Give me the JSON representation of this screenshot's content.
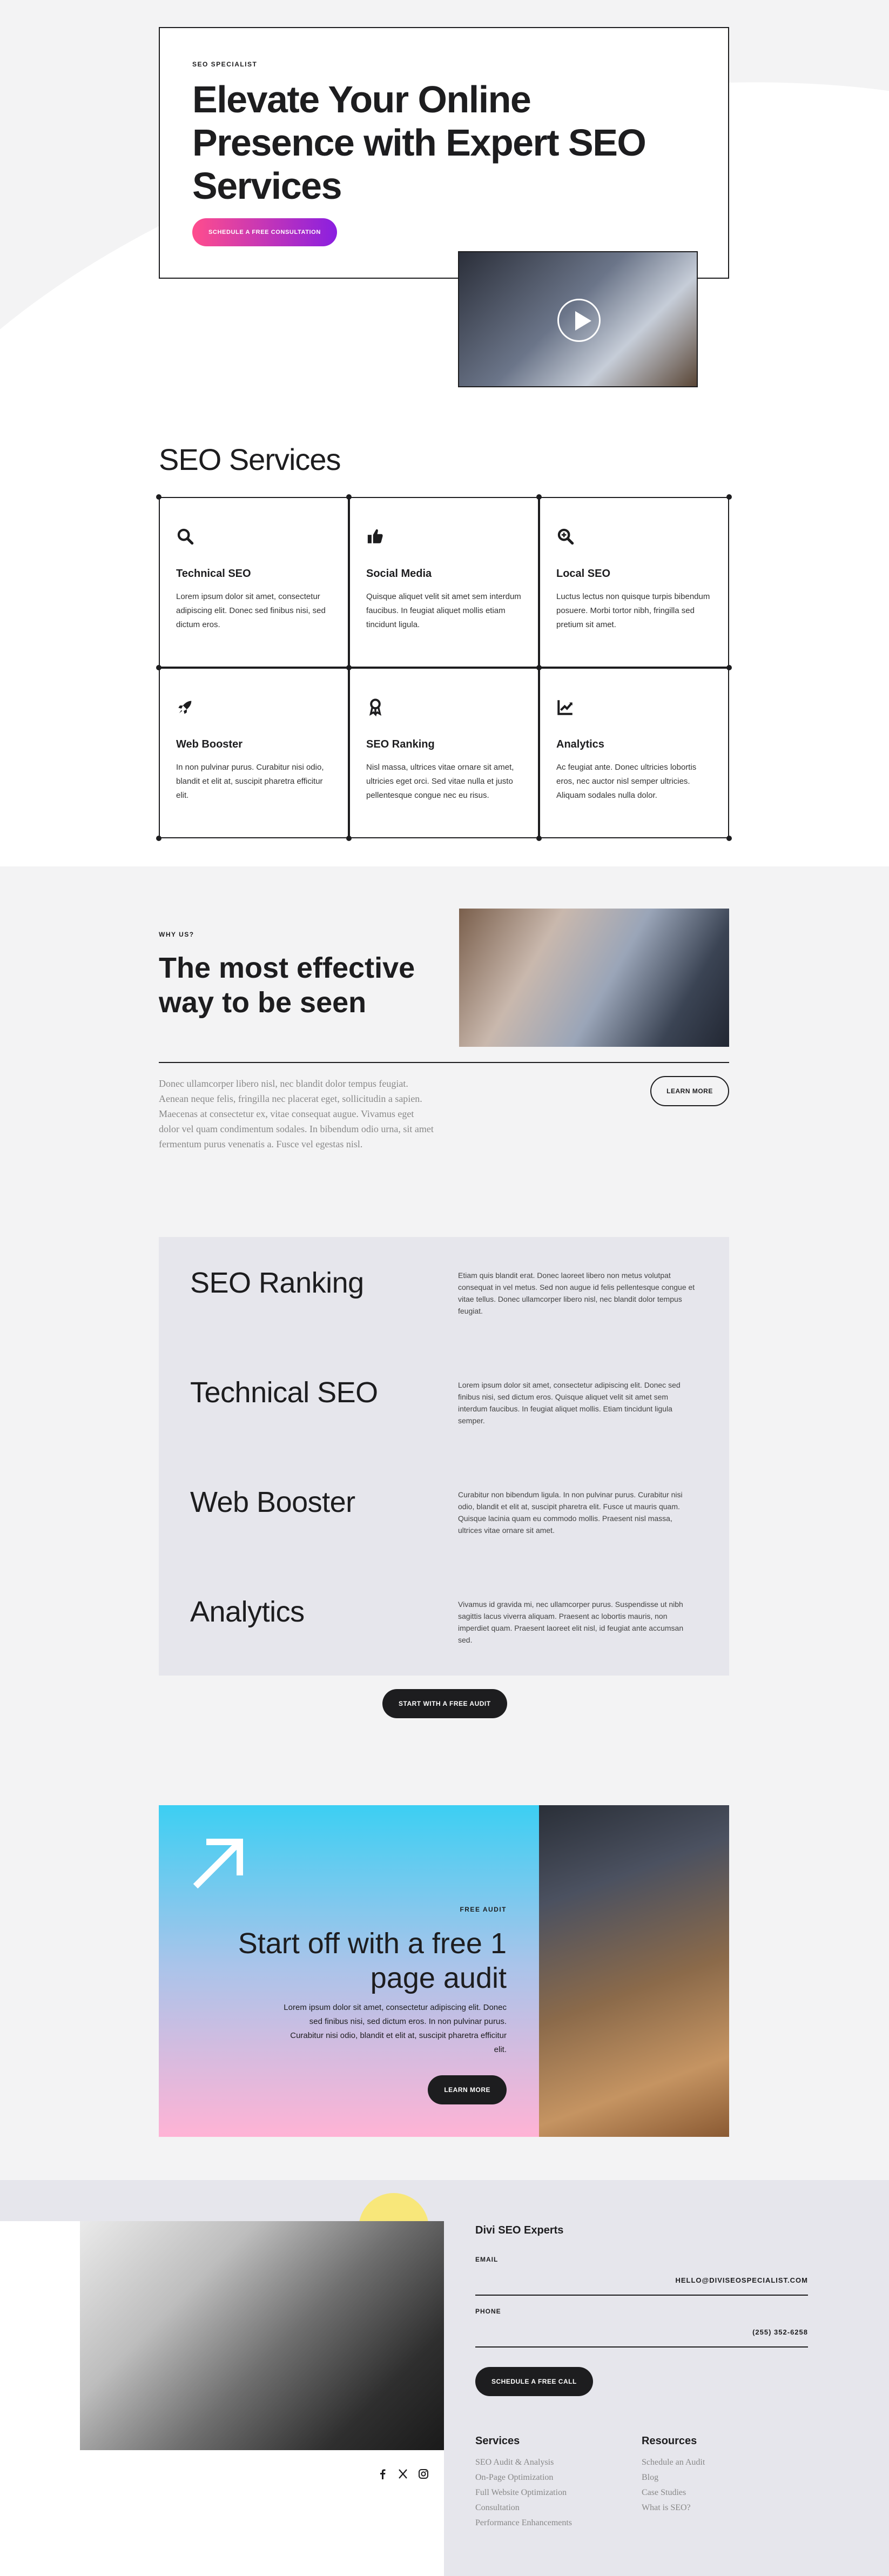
{
  "hero": {
    "eyebrow": "SEO SPECIALIST",
    "title": "Elevate Your Online Presence with Expert SEO Services",
    "cta": "SCHEDULE A FREE CONSULTATION"
  },
  "services": {
    "title": "SEO Services",
    "items": [
      {
        "icon": "search-icon",
        "title": "Technical SEO",
        "text": "Lorem ipsum dolor sit amet, consectetur adipiscing elit. Donec sed finibus nisi, sed dictum eros."
      },
      {
        "icon": "thumbs-up-icon",
        "title": "Social Media",
        "text": "Quisque aliquet velit sit amet sem interdum faucibus. In feugiat aliquet mollis etiam tincidunt ligula."
      },
      {
        "icon": "search-plus-icon",
        "title": "Local SEO",
        "text": "Luctus lectus non quisque turpis bibendum posuere. Morbi tortor nibh, fringilla sed pretium sit amet."
      },
      {
        "icon": "rocket-icon",
        "title": "Web Booster",
        "text": "In non pulvinar purus. Curabitur nisi odio, blandit et elit at, suscipit pharetra efficitur elit."
      },
      {
        "icon": "award-icon",
        "title": "SEO Ranking",
        "text": "Nisl massa, ultrices vitae ornare sit amet, ultricies eget orci. Sed vitae nulla et justo pellentesque congue nec eu risus."
      },
      {
        "icon": "chart-line-icon",
        "title": "Analytics",
        "text": "Ac feugiat ante. Donec ultricies lobortis eros, nec auctor nisl semper ultricies. Aliquam sodales nulla dolor."
      }
    ]
  },
  "why": {
    "eyebrow": "WHY US?",
    "title": "The most effective way to be seen",
    "text": "Donec ullamcorper libero nisl, nec blandit dolor tempus feugiat. Aenean neque felis, fringilla nec placerat eget, sollicitudin a sapien. Maecenas at consectetur ex, vitae consequat augue. Vivamus eget dolor vel quam condimentum sodales. In bibendum odio urna, sit amet fermentum purus venenatis a. Fusce vel egestas nisl.",
    "cta": "LEARN MORE"
  },
  "features": {
    "items": [
      {
        "title": "SEO Ranking",
        "text": "Etiam quis blandit erat. Donec laoreet libero non metus volutpat consequat in vel metus. Sed non augue id felis pellentesque congue et vitae tellus. Donec ullamcorper libero nisl, nec blandit dolor tempus feugiat."
      },
      {
        "title": "Technical SEO",
        "text": "Lorem ipsum dolor sit amet, consectetur adipiscing elit. Donec sed finibus nisi, sed dictum eros. Quisque aliquet velit sit amet sem interdum faucibus. In feugiat aliquet mollis. Etiam tincidunt ligula semper."
      },
      {
        "title": "Web Booster",
        "text": "Curabitur non bibendum ligula. In non pulvinar purus. Curabitur nisi odio, blandit et elit at, suscipit pharetra elit. Fusce ut mauris quam. Quisque lacinia quam eu commodo mollis. Praesent nisl massa, ultrices vitae ornare sit amet."
      },
      {
        "title": "Analytics",
        "text": "Vivamus id gravida mi, nec ullamcorper purus. Suspendisse ut nibh sagittis lacus viverra aliquam. Praesent ac lobortis mauris, non imperdiet quam. Praesent laoreet elit nisl, id feugiat ante accumsan sed."
      }
    ],
    "cta": "START WITH A FREE AUDIT"
  },
  "audit": {
    "eyebrow": "FREE AUDIT",
    "title": "Start off with a free 1 page audit",
    "text": "Lorem ipsum dolor sit amet, consectetur adipiscing elit. Donec sed finibus nisi, sed dictum eros. In non pulvinar purus. Curabitur nisi odio, blandit et elit at, suscipit pharetra efficitur elit.",
    "cta": "LEARN MORE"
  },
  "footer": {
    "brand": "Divi SEO Experts",
    "email_label": "EMAIL",
    "email": "HELLO@DIVISEOSPECIALIST.COM",
    "phone_label": "PHONE",
    "phone": "(255) 352-6258",
    "cta": "SCHEDULE A FREE CALL",
    "services_title": "Services",
    "services": [
      "SEO Audit & Analysis",
      "On-Page Optimization",
      "Full Website Optimization",
      "Consultation",
      "Performance Enhancements"
    ],
    "resources_title": "Resources",
    "resources": [
      "Schedule an Audit",
      "Blog",
      "Case Studies",
      "What is SEO?"
    ],
    "social": [
      "facebook-icon",
      "x-icon",
      "instagram-icon"
    ]
  },
  "colors": {
    "dark": "#1d1d1f",
    "gradient_start": "#ff4d8d",
    "gradient_end": "#8a1fe0",
    "panel": "#e6e6ec",
    "section_bg": "#f3f3f4"
  }
}
